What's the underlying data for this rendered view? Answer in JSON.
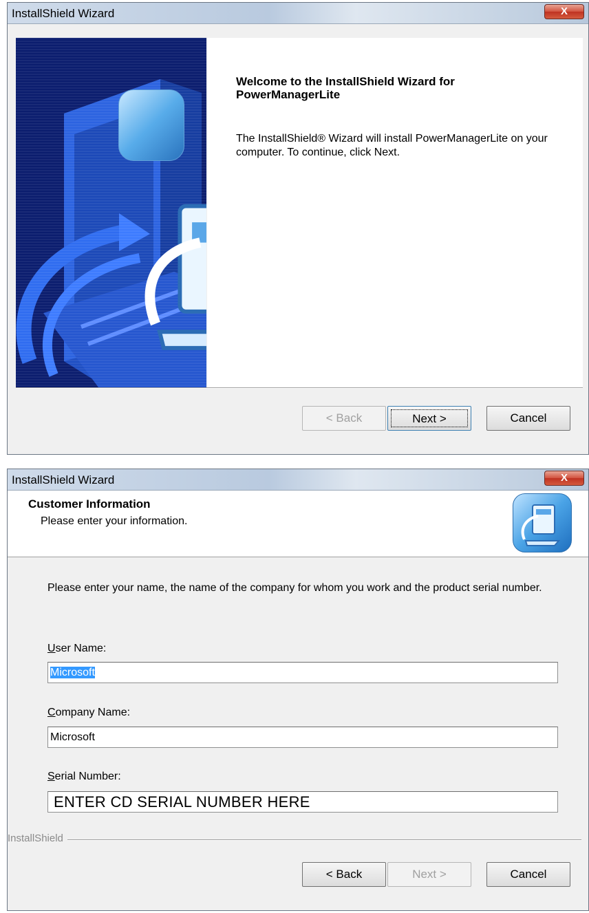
{
  "window1": {
    "title": "InstallShield Wizard",
    "close_label": "X",
    "welcome_title": "Welcome to the InstallShield Wizard for PowerManagerLite",
    "welcome_text": "The InstallShield® Wizard will install PowerManagerLite on your computer.  To continue, click Next.",
    "buttons": {
      "back": "< Back",
      "next": "Next >",
      "cancel": "Cancel"
    }
  },
  "window2": {
    "title": "InstallShield Wizard",
    "close_label": "X",
    "header_title": "Customer Information",
    "header_subtitle": "Please enter your information.",
    "intro": "Please enter your name, the name of the company for whom you work and the product serial number.",
    "user_name": {
      "label_key": "U",
      "label_rest": "ser Name:",
      "value": "Microsoft"
    },
    "company_name": {
      "label_key": "C",
      "label_rest": "ompany Name:",
      "value": "Microsoft"
    },
    "serial_number": {
      "label_key": "S",
      "label_rest": "erial Number:",
      "value": "ENTER CD SERIAL NUMBER HERE"
    },
    "brand": "InstallShield",
    "buttons": {
      "back": "< Back",
      "next": "Next >",
      "cancel": "Cancel"
    }
  },
  "colors": {
    "banner_bg": "#0b1d6e",
    "selection": "#3399ff",
    "close_red": "#c9452f"
  },
  "icons": [
    "installer-computer-icon",
    "close-icon"
  ]
}
